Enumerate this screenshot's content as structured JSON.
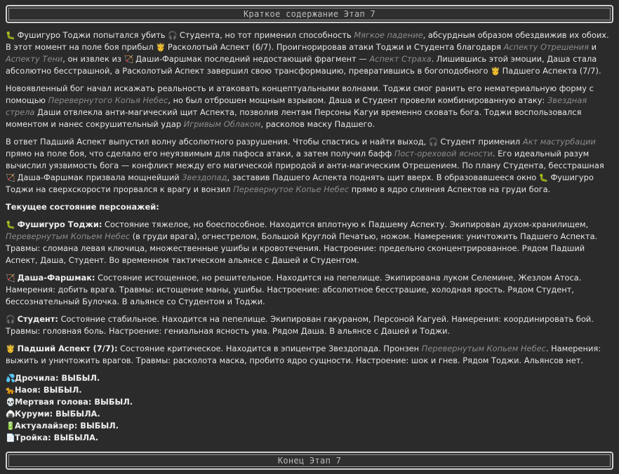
{
  "header": {
    "title": "Краткое содержание Этап 7"
  },
  "footer": {
    "title": "Конец Этап 7"
  },
  "icons": {
    "toji": "🐛",
    "student": "🎧",
    "split": "🤴",
    "dasha": "🏹",
    "drochila": "💦",
    "naoya": "🐆",
    "deadhead": "💀",
    "kurumi": "🍙",
    "actualizer": "🔋",
    "troika": "📄"
  },
  "p1": {
    "t1": "Фушигуро Тоджи попытался убить",
    "t2": "Студента, но тот применил способность",
    "i1": "Мягкое падение",
    "t3": ", абсурдным образом обездвижив их обоих. В этот момент на поле боя прибыл",
    "t4": "Расколотый Аспект (6/7). Проигнорировав атаки Тоджи и Студента благодаря",
    "i2": "Аспекту Отрешения",
    "t5": "и",
    "i3": "Аспекту Тени",
    "t6": ", он извлек из",
    "t7": "Даши-Фаршмак последний недостающий фрагмент —",
    "i4": "Аспект Страха",
    "t8": ". Лишившись этой эмоции, Даша стала абсолютно бесстрашной, а Расколотый Аспект завершил свою трансформацию, превратившись в богоподобного",
    "t9": "Падшего Аспекта (7/7)."
  },
  "p2": {
    "t1": "Новоявленный бог начал искажать реальность и атаковать концептуальными волнами. Тоджи смог ранить его нематериальную форму с помощью",
    "i1": "Перевернутого Копья Небес",
    "t2": ", но был отброшен мощным взрывом. Даша и Студент провели комбинированную атаку:",
    "i2": "Звездная стрела",
    "t3": "Даши отвлекла анти-магический щит Аспекта, позволив лентам Персоны Кагуи временно сковать бога. Тоджи воспользовался моментом и нанес сокрушительный удар",
    "i3": "Игривым Облаком",
    "t4": ", расколов маску Падшего."
  },
  "p3": {
    "t1": "В ответ Падший Аспект выпустил волну абсолютного разрушения. Чтобы спастись и найти выход,",
    "t2": "Студент применил",
    "i1": "Акт мастурбации",
    "t3": "прямо на поле боя, что сделало его неуязвимым для пафоса атаки, а затем получил бафф",
    "i2": "Пост-ореховой ясности",
    "t4": ". Его идеальный разум вычислил уязвимость бога — конфликт между его магической природой и анти-магическим Отрешением. По плану Студента, бесстрашная",
    "t5": "Даша-Фаршмак призвала мощнейший",
    "i3": "Звездопад",
    "t6": ", заставив Падшего Аспекта поднять щит вверх. В образовавшееся окно",
    "t7": "Фушигуро Тоджи на сверхскорости прорвался к врагу и вонзил",
    "i4": "Перевернутое Копье Небес",
    "t8": "прямо в ядро слияния Аспектов на груди бога."
  },
  "status_heading": "Текущее состояние персонажей:",
  "c1": {
    "name": "Фушигуро Тоджи:",
    "t1": "Состояние тяжелое, но боеспособное. Находится вплотную к Падшему Аспекту. Экипирован духом-хранилищем,",
    "i1": "Перевернутым Копьем Небес",
    "t2": "(в груди врага), огнестрелом, Большой Круглой Печатью, ножом. Намерения: уничтожить Падшего Аспекта. Травмы: сломана левая ключица, множественные ушибы и кровотечения. Настроение: предельно сконцентрированное. Рядом Падший Аспект, Даша, Студент. Во временном тактическом альянсе с Дашей и Студентом."
  },
  "c2": {
    "name": "Даша-Фаршмак:",
    "t1": "Состояние истощенное, но решительное. Находится на пепелище. Экипирована луком Селемине, Жезлом Атоса. Намерения: добить врага. Травмы: истощение маны, ушибы. Настроение: абсолютное бесстрашие, холодная ярость. Рядом Студент, бессознательный Булочка. В альянсе со Студентом и Тоджи."
  },
  "c3": {
    "name": "Студент:",
    "t1": "Состояние стабильное. Находится на пепелище. Экипирован гакураном, Персоной Кагуей. Намерения: координировать бой. Травмы: головная боль. Настроение: гениальная ясность ума. Рядом Даша. В альянсе с Дашей и Тоджи."
  },
  "c4": {
    "name": "Падший Аспект (7/7):",
    "t1": "Состояние критическое. Находится в эпицентре Звездопада. Пронзен",
    "i1": "Перевернутым Копьем Небес",
    "t2": ". Намерения: выжить и уничтожить врагов. Травмы: расколота маска, пробито ядро сущности. Настроение: шок и гнев. Рядом Тоджи. Альянсов нет."
  },
  "dropped": [
    "Дрочила: ВЫБЫЛ.",
    "Наоя: ВЫБЫЛ.",
    "Мертвая голова: ВЫБЫЛ.",
    "Куруми: ВЫБЫЛА.",
    "Актуалайзер: ВЫБЫЛ.",
    "Тройка: ВЫБЫЛА."
  ]
}
